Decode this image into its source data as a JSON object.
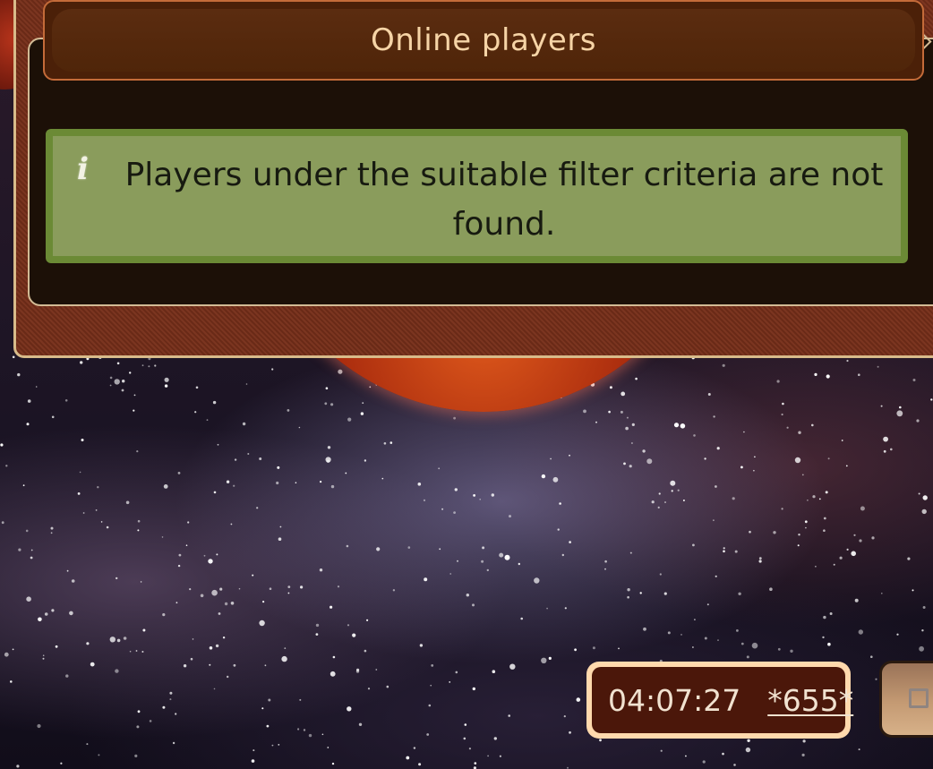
{
  "dialog": {
    "title": "Online players",
    "message": "Players under the suitable filter criteria are not found.",
    "message_icon": "info-icon"
  },
  "status": {
    "time": "04:07:27",
    "code": "*655*"
  },
  "side_button": {
    "icon": "square-icon"
  },
  "colors": {
    "title_text": "#f6d4a6",
    "info_background": "#8a9c5c",
    "info_border": "#6b8a35",
    "panel_background": "#1c1007",
    "clock_background": "#4b170a",
    "clock_border": "#ffd9ad"
  }
}
